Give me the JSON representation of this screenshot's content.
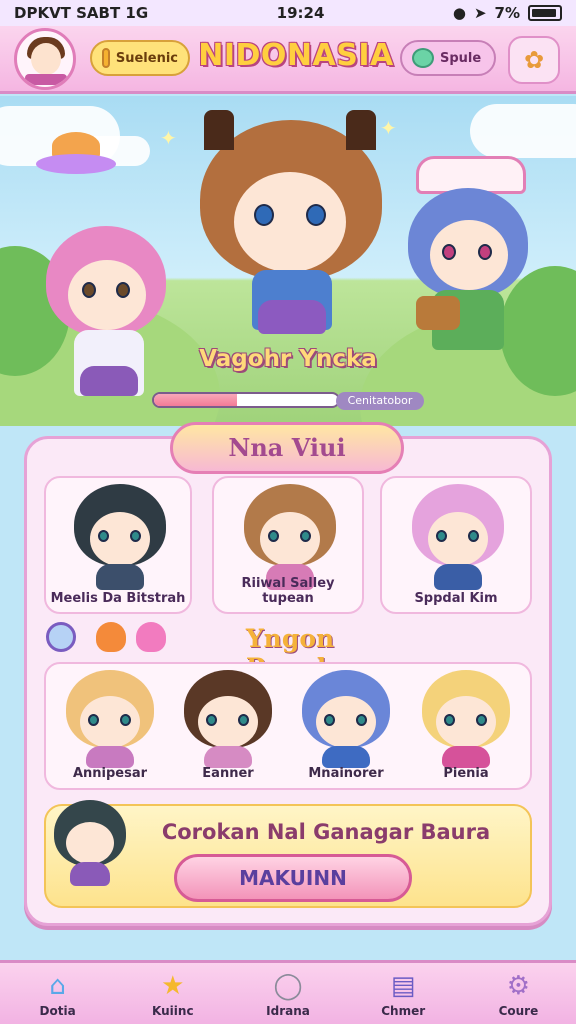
{
  "status_bar": {
    "left_text": "DPKVT SABT 1G",
    "time": "19:24",
    "battery": "7%"
  },
  "header": {
    "title": "NIDONASIA",
    "left_pill_label": "Suelenic",
    "right_pill_label": "Spule",
    "menu_icon": "flower-icon"
  },
  "hero": {
    "character_name": "Vagohr Yncka",
    "progress_label": "Cenitatobor",
    "progress_fraction": 0.45,
    "accent_color": "#f37b97"
  },
  "panel": {
    "tab_title": "Nna Viui",
    "featured": [
      {
        "label": "Meelis Da Bitstrah",
        "hair": "#2f3b44",
        "outfit": "#3c4f6b"
      },
      {
        "label": "Riiwal Salley tupean",
        "hair": "#b27a4a",
        "outfit": "#d77bb6"
      },
      {
        "label": "Sppdal Kim",
        "hair": "#e5a3dd",
        "outfit": "#3a5ea6"
      }
    ],
    "section_title": "Yngon Rauck",
    "squad": [
      {
        "label": "Annipesar",
        "hair": "#f0c27b",
        "outfit": "#c87ac0"
      },
      {
        "label": "Eanner",
        "hair": "#5a3826",
        "outfit": "#d68bc3"
      },
      {
        "label": "Mnainorer",
        "hair": "#6a86d8",
        "outfit": "#3e6bc2"
      },
      {
        "label": "Pienia",
        "hair": "#f4d27a",
        "outfit": "#d6529a"
      }
    ],
    "quest_title": "Corokan Nal Ganagar Baura",
    "quest_button": "MAKUINN"
  },
  "nav": [
    {
      "label": "Dotia",
      "icon": "house-icon"
    },
    {
      "label": "Kuiinc",
      "icon": "star-icon"
    },
    {
      "label": "Idrana",
      "icon": "circle-icon"
    },
    {
      "label": "Chmer",
      "icon": "chat-icon"
    },
    {
      "label": "Coure",
      "icon": "gear-icon"
    }
  ]
}
